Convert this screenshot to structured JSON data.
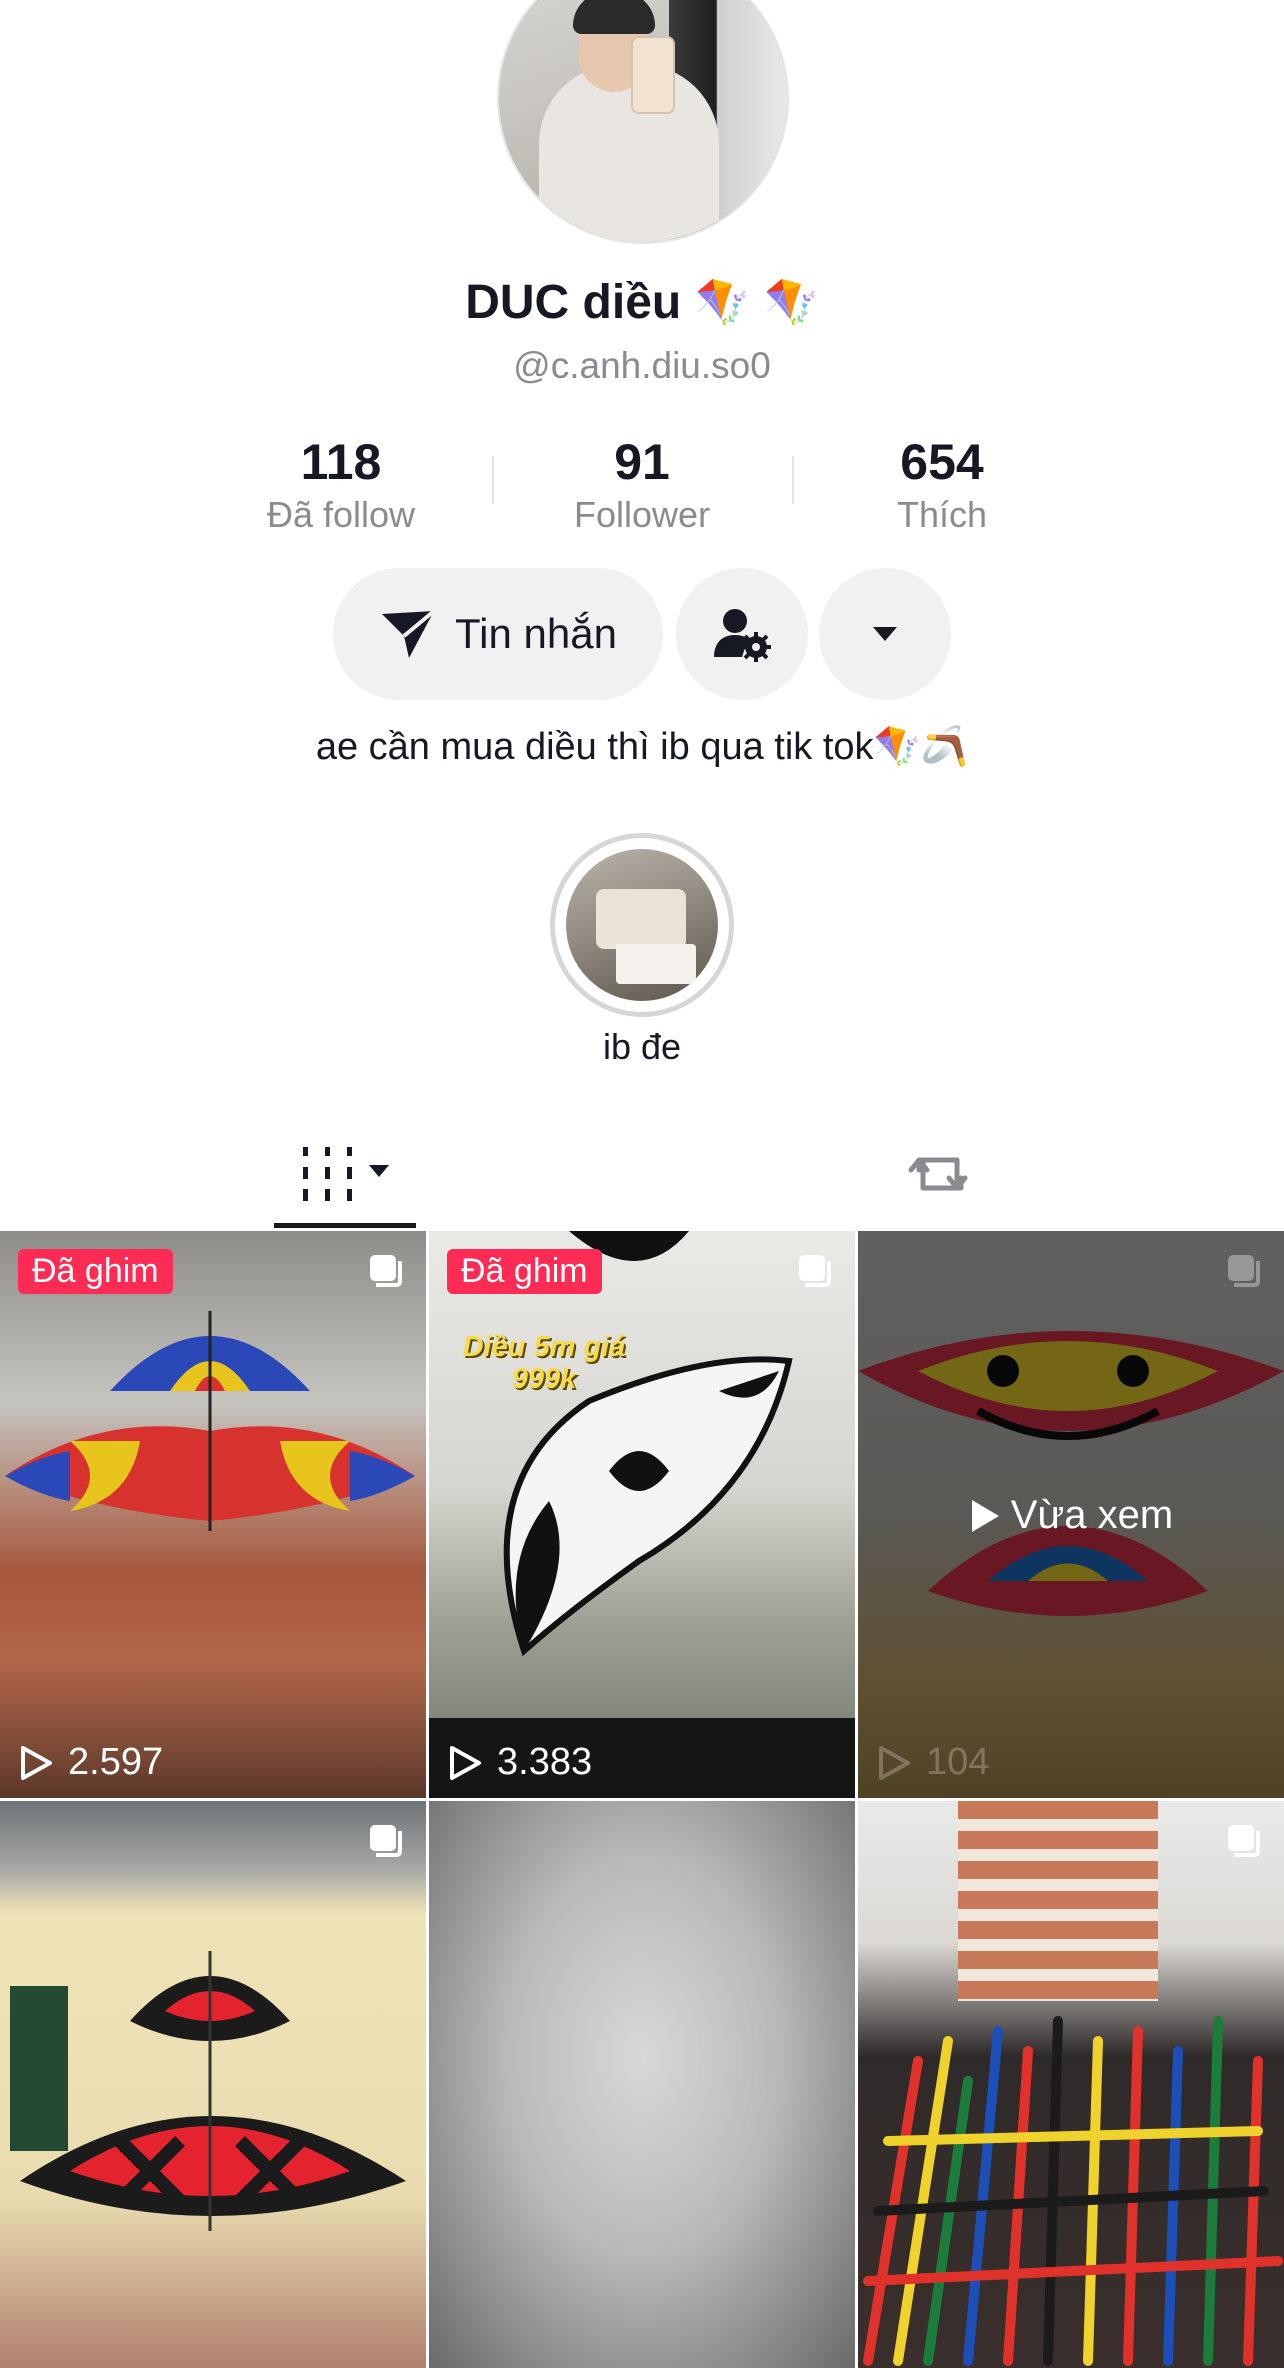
{
  "profile": {
    "display_name": "DUC diều",
    "name_emojis": [
      "🪁",
      "🪁"
    ],
    "handle": "@c.anh.diu.so0",
    "bio": "ae cần mua diều thì ib qua tik tok🪁🪃"
  },
  "stats": [
    {
      "value": "118",
      "label": "Đã follow"
    },
    {
      "value": "91",
      "label": "Follower"
    },
    {
      "value": "654",
      "label": "Thích"
    }
  ],
  "actions": {
    "message_label": "Tin nhắn",
    "message_icon": "send-icon",
    "profile_icon": "user-settings-icon",
    "more_icon": "caret-down-icon"
  },
  "highlight": {
    "label": "ib đe"
  },
  "tabs": [
    {
      "icon": "grid-videos-icon",
      "active": true
    },
    {
      "icon": "repost-icon",
      "active": false
    }
  ],
  "videos": [
    {
      "pinned_label": "Đã ghim",
      "views": "2.597",
      "multi": true
    },
    {
      "pinned_label": "Đã ghim",
      "views": "3.383",
      "multi": true,
      "caption": "Diều 5m giá 999k"
    },
    {
      "views": "104",
      "multi": true,
      "overlay": "Vừa xem"
    },
    {
      "multi": true
    },
    {},
    {
      "multi": true
    }
  ],
  "colors": {
    "pin": "#fe2c55",
    "text": "#161823",
    "secondary": "#8a8b91",
    "button_bg": "#f1f1f2"
  }
}
